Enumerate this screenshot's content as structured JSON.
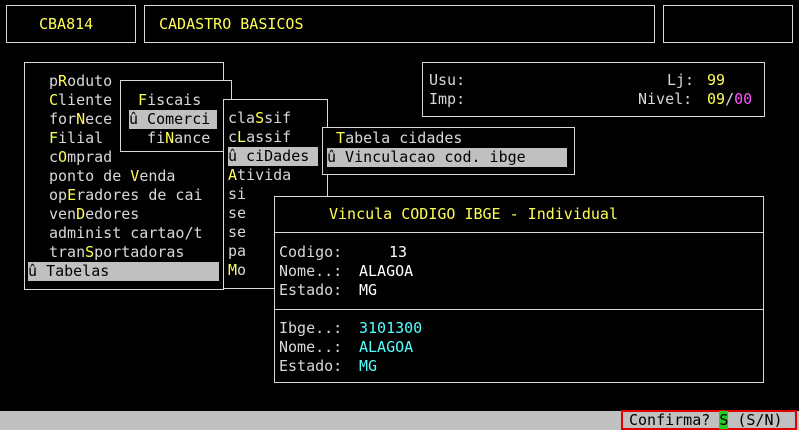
{
  "header": {
    "code": "CBA814",
    "title": "CADASTRO BASICOS"
  },
  "info": {
    "usu_label": "Usu:",
    "imp_label": "Imp:",
    "lj_label": "Lj:",
    "lj_value": "99",
    "nivel_label": "Nivel:",
    "nivel_value_a": "09",
    "nivel_sep": "/",
    "nivel_value_b": "00"
  },
  "main_menu": [
    {
      "pre": "p",
      "hot": "R",
      "post": "oduto"
    },
    {
      "pre": "",
      "hot": "C",
      "post": "liente"
    },
    {
      "pre": "for",
      "hot": "N",
      "post": "ece"
    },
    {
      "pre": "",
      "hot": "F",
      "post": "ilial"
    },
    {
      "pre": "c",
      "hot": "O",
      "post": "mprad"
    },
    {
      "pre": "ponto de ",
      "hot": "V",
      "post": "enda"
    },
    {
      "pre": "op",
      "hot": "E",
      "post": "radores de cai"
    },
    {
      "pre": "ven",
      "hot": "D",
      "post": "edores"
    },
    {
      "pre": "administ cartao/t",
      "hot": "",
      "post": ""
    },
    {
      "pre": "tran",
      "hot": "S",
      "post": "portadoras"
    },
    {
      "pre": "û ",
      "hot": "T",
      "post": "abelas",
      "selected": true
    }
  ],
  "sub_menu_1": [
    {
      "pre": " ",
      "hot": "F",
      "post": "iscais"
    },
    {
      "pre": "û Comerci",
      "hot": "",
      "post": "",
      "selected": true
    },
    {
      "pre": "  fi",
      "hot": "N",
      "post": "ance"
    }
  ],
  "sub_menu_2": [
    {
      "pre": "cla",
      "hot": "S",
      "post": "sif"
    },
    {
      "pre": "c",
      "hot": "L",
      "post": "assif"
    },
    {
      "pre": "û ci",
      "hot": "D",
      "post": "ades",
      "selected": true
    },
    {
      "pre": "",
      "hot": "A",
      "post": "tivida"
    },
    {
      "pre": "si",
      "hot": "",
      "post": ""
    },
    {
      "pre": "se",
      "hot": "",
      "post": ""
    },
    {
      "pre": "se",
      "hot": "",
      "post": ""
    },
    {
      "pre": "pa",
      "hot": "",
      "post": ""
    },
    {
      "pre": "",
      "hot": "M",
      "post": "o"
    }
  ],
  "sub_menu_3": [
    {
      "pre": " ",
      "hot": "T",
      "post": "abela cidades"
    },
    {
      "pre": "û Vinculacao cod. ibge",
      "hot": "",
      "post": "",
      "selected": true
    }
  ],
  "dialog": {
    "title": "Vincula CODIGO IBGE - Individual",
    "codigo_label": "Codigo:",
    "codigo_value": "13",
    "nome_label": "Nome..:",
    "nome_value": "ALAGOA",
    "estado_label": "Estado:",
    "estado_value": "MG",
    "ibge_label": "Ibge..:",
    "ibge_value": "3101300",
    "nome2_label": "Nome..:",
    "nome2_value": "ALAGOA",
    "estado2_label": "Estado:",
    "estado2_value": "MG"
  },
  "status": {
    "confirm_label": "Confirma? ",
    "confirm_answer": "S",
    "confirm_options": " (S/N)"
  }
}
